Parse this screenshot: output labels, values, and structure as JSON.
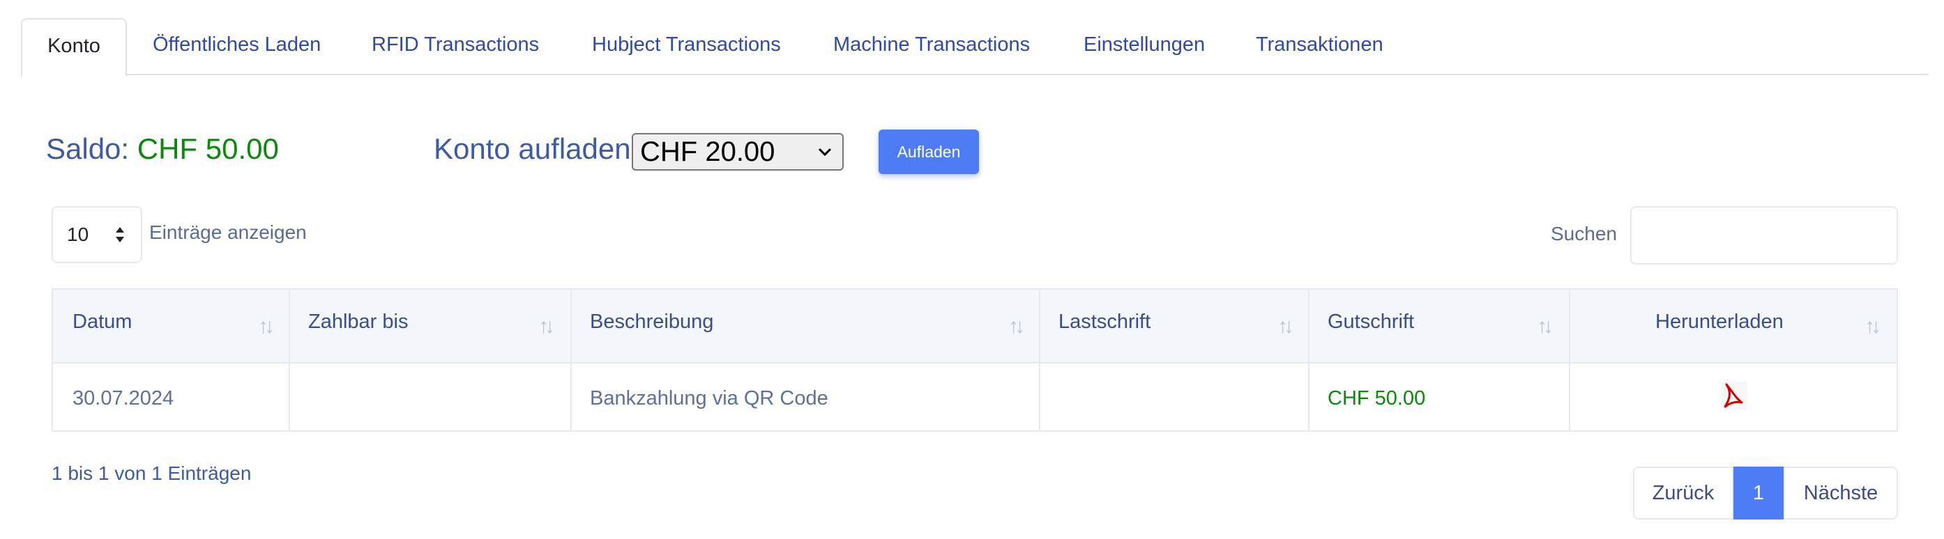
{
  "tabs": [
    {
      "label": "Konto",
      "active": true
    },
    {
      "label": "Öffentliches Laden"
    },
    {
      "label": "RFID Transactions"
    },
    {
      "label": "Hubject Transactions"
    },
    {
      "label": "Machine Transactions"
    },
    {
      "label": "Einstellungen"
    },
    {
      "label": "Transaktionen"
    }
  ],
  "balance": {
    "label": "Saldo:",
    "amount": "CHF 50.00"
  },
  "topup": {
    "label": "Konto aufladen",
    "selected": "CHF 20.00",
    "button": "Aufladen"
  },
  "length": {
    "value": "10",
    "label": "Einträge anzeigen"
  },
  "search": {
    "label": "Suchen",
    "value": ""
  },
  "table": {
    "columns": [
      "Datum",
      "Zahlbar bis",
      "Beschreibung",
      "Lastschrift",
      "Gutschrift",
      "Herunterladen"
    ],
    "rows": [
      {
        "datum": "30.07.2024",
        "zahlbar_bis": "",
        "beschreibung": "Bankzahlung via QR Code",
        "lastschrift": "",
        "gutschrift": "CHF 50.00",
        "download_icon": "pdf-icon"
      }
    ]
  },
  "info": "1 bis 1 von 1 Einträgen",
  "pagination": {
    "prev": "Zurück",
    "current": "1",
    "next": "Nächste"
  },
  "colors": {
    "primary": "#4d7cf5",
    "positive": "#0a8a0a",
    "link": "#2f4aa6",
    "pdf": "#d40000"
  }
}
